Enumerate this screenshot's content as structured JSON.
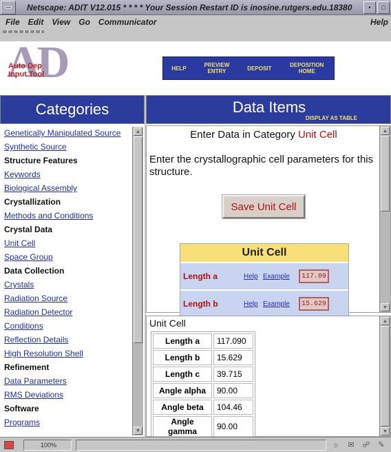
{
  "window": {
    "title": "Netscape: ADIT V12.015 * * * * Your Session Restart ID is inosine.rutgers.edu.18380"
  },
  "menu": {
    "items": [
      "File",
      "Edit",
      "View",
      "Go",
      "Communicator"
    ],
    "help": "Help"
  },
  "logo": {
    "big": "AD",
    "line1": "Auto Dep",
    "line2": "Input Tool"
  },
  "nav": {
    "items": [
      {
        "label": "HELP"
      },
      {
        "label": "PREVIEW ENTRY"
      },
      {
        "label": "DEPOSIT"
      },
      {
        "label": "DEPOSITION HOME"
      }
    ]
  },
  "left": {
    "heading": "Categories",
    "items": [
      {
        "label": "Genetically Manipulated Source",
        "kind": "link"
      },
      {
        "label": "Synthetic Source",
        "kind": "link"
      },
      {
        "label": "Structure Features",
        "kind": "head"
      },
      {
        "label": "Keywords",
        "kind": "link"
      },
      {
        "label": "Biological Assembly",
        "kind": "link"
      },
      {
        "label": "Crystallization",
        "kind": "head"
      },
      {
        "label": "Methods and Conditions",
        "kind": "link"
      },
      {
        "label": "Crystal Data",
        "kind": "head"
      },
      {
        "label": "Unit Cell",
        "kind": "link"
      },
      {
        "label": "Space Group",
        "kind": "link"
      },
      {
        "label": "Data Collection",
        "kind": "head"
      },
      {
        "label": "Crystals",
        "kind": "link"
      },
      {
        "label": "Radiation Source",
        "kind": "link"
      },
      {
        "label": "Radiation Detector",
        "kind": "link"
      },
      {
        "label": "Conditions",
        "kind": "link"
      },
      {
        "label": "Reflection Details",
        "kind": "link"
      },
      {
        "label": "High Resolution Shell",
        "kind": "link"
      },
      {
        "label": "Refinement",
        "kind": "head"
      },
      {
        "label": "Data Parameters",
        "kind": "link"
      },
      {
        "label": "RMS Deviations",
        "kind": "link"
      },
      {
        "label": "Software",
        "kind": "head"
      },
      {
        "label": "Programs",
        "kind": "link"
      }
    ]
  },
  "right": {
    "heading": "Data Items",
    "display_as_table": "DISPLAY AS TABLE",
    "enter_prefix": "Enter Data in Category ",
    "enter_category": "Unit Cell",
    "description": "Enter the crystallographic cell parameters for this structure.",
    "save_button": "Save Unit Cell",
    "form": {
      "title": "Unit Cell",
      "rows": [
        {
          "label": "Length a",
          "help": "Help",
          "example": "Example",
          "value": "117.09"
        },
        {
          "label": "Length b",
          "help": "Help",
          "example": "Example",
          "value": "15.629"
        }
      ]
    },
    "summary": {
      "title": "Unit Cell",
      "rows": [
        {
          "key": "Length a",
          "value": "117.090"
        },
        {
          "key": "Length b",
          "value": "15.629"
        },
        {
          "key": "Length c",
          "value": "39.715"
        },
        {
          "key": "Angle alpha",
          "value": "90.00"
        },
        {
          "key": "Angle beta",
          "value": "104.46"
        },
        {
          "key": "Angle gamma",
          "value": "90.00"
        }
      ]
    }
  },
  "status": {
    "progress": "100%"
  }
}
